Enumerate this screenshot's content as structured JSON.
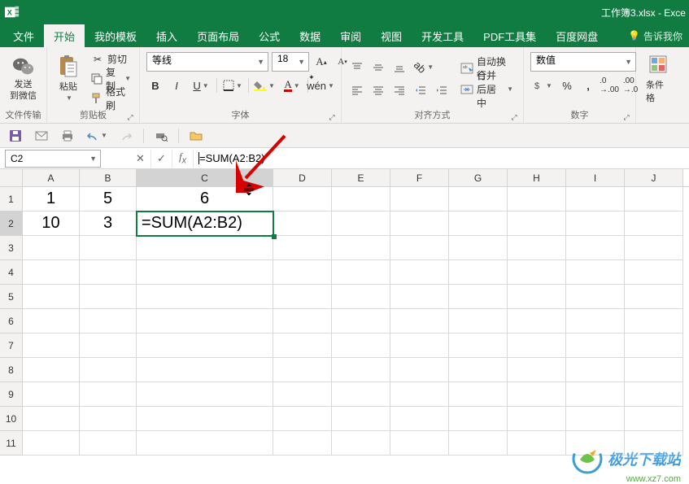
{
  "title": "工作簿3.xlsx - Exce",
  "tabs": [
    "文件",
    "开始",
    "我的模板",
    "插入",
    "页面布局",
    "公式",
    "数据",
    "审阅",
    "视图",
    "开发工具",
    "PDF工具集",
    "百度网盘"
  ],
  "active_tab_index": 1,
  "tell_me": "告诉我你",
  "clipboard": {
    "wechat_label": "发送\n到微信",
    "paste_label": "粘贴",
    "cut": "剪切",
    "copy": "复制",
    "format_painter": "格式刷",
    "group_label_left": "文件传输",
    "group_label": "剪贴板"
  },
  "font": {
    "name": "等线",
    "size": "18",
    "group_label": "字体"
  },
  "alignment": {
    "wrap": "自动换行",
    "merge": "合并后居中",
    "group_label": "对齐方式"
  },
  "number": {
    "format": "数值",
    "group_label": "数字"
  },
  "styles": {
    "cond_fmt": "条件格"
  },
  "name_box": "C2",
  "formula": "=SUM(A2:B2)",
  "columns": [
    "A",
    "B",
    "C",
    "D",
    "E",
    "F",
    "G",
    "H",
    "I",
    "J"
  ],
  "rows": [
    "1",
    "2",
    "3",
    "4",
    "5",
    "6",
    "7",
    "8",
    "9",
    "10",
    "11"
  ],
  "selected_col": "C",
  "selected_row": "2",
  "cells": {
    "A1": "1",
    "B1": "5",
    "C1": "6",
    "A2": "10",
    "B2": "3",
    "C2": "=SUM(A2:B2)"
  },
  "watermark": {
    "text": "极光下载站",
    "url": "www.xz7.com"
  }
}
